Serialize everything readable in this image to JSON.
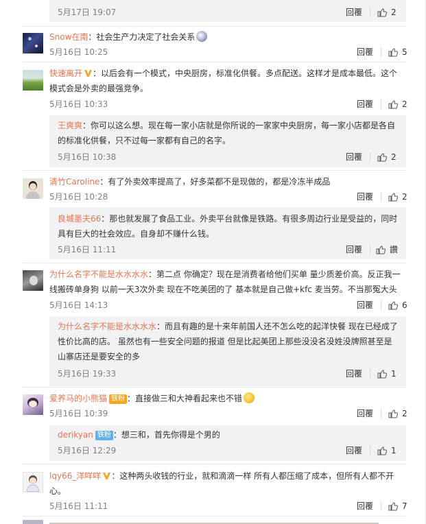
{
  "comments": [
    {
      "reply_time": "5月17日 19:07",
      "reply_label": "回覆",
      "reply_likes": "2"
    },
    {
      "user": "Snow在南",
      "text": "：社会生产力决定了社会关系",
      "time": "5月16日 10:25",
      "reply_label": "回覆",
      "likes": "5"
    },
    {
      "user": "快速离开",
      "text_line1": "：以后会有一个模式，中央厨房，标准化供餐。多点配送。这样才是成本最低。这个",
      "text_line2": "模式会是外卖的最强竞争。",
      "time": "5月16日 10:33",
      "reply_label": "回覆",
      "likes": "2",
      "reply": {
        "user": "王爽爽",
        "text_line1": "：你可以这么想。现在每一家小店就是你所说的一家家中央厨房，每一家小店都是各自",
        "text_line2": "的标准化供餐，只不过每一家都有自己的名字。",
        "time": "5月16日 10:38",
        "reply_label": "回覆",
        "likes": "2"
      }
    },
    {
      "user": "清竹Caroline",
      "text": "：有了外卖效率提高了，好多菜都不是现做的，都是冷冻半成品",
      "time": "5月16日 10:28",
      "reply_label": "回覆",
      "likes": "2",
      "reply": {
        "user": "良城墨夫66",
        "text_line1": "：那也就发展了食品工业。外卖平台就像是铁路。有很多周边行业是受益的，同时",
        "text_line2": "具有巨大的社会效应。自身却不赚什么钱。",
        "time": "5月16日 11:11",
        "reply_label": "回覆",
        "likes": "讚"
      }
    },
    {
      "user": "为什么名字不能是水水水水",
      "text_line1": "：第二点 你确定？现在是消费者给他们买单 量少质差价高。反正我一",
      "text_line2": "线搬砖单身狗 以前一天3次外卖 现在不吃美团的了 基本就是自己做+kfc 麦当劳。不当那冤大头",
      "time": "5月16日 14:13",
      "reply_label": "回覆",
      "likes": "6",
      "reply": {
        "user": "为什么名字不能是水水水水",
        "text_line1": "：而且有趣的是十来年前国人还不怎么吃的起洋快餐 现在已经成了",
        "text_line2": "性价比高的店。 虽然也有一些安全问题的报道 但是比起美团上那些没没名没姓没牌照甚至是",
        "text_line3": "山寨店还是要安全的多",
        "time": "5月16日 19:33",
        "reply_label": "回覆",
        "likes": "1"
      }
    },
    {
      "user": "爱养马的小熊猫",
      "badge": "铁粉",
      "text": "：直接做三和大神看起来也不错",
      "time": "5月16日 10:39",
      "reply_label": "回覆",
      "likes": "2",
      "reply": {
        "user": "derikyan",
        "badge": "铁粉",
        "text": "：想三和，首先你得是个男的",
        "time": "5月16日 12:29",
        "reply_label": "回覆",
        "likes": "1"
      }
    },
    {
      "user": "lqy66_洋咩咩",
      "text_line1": "：这种两头收钱的行业，就和滴滴一样 所有人都压缩了成本，但所有人都不开",
      "text_line2": "心。",
      "time": "5月16日 11:11",
      "reply_label": "回覆",
      "likes": "7"
    }
  ],
  "colors": {
    "name": "#eb7350",
    "reply_bg": "#f2f2f5",
    "time": "#808080",
    "vip": "#f6a623"
  }
}
